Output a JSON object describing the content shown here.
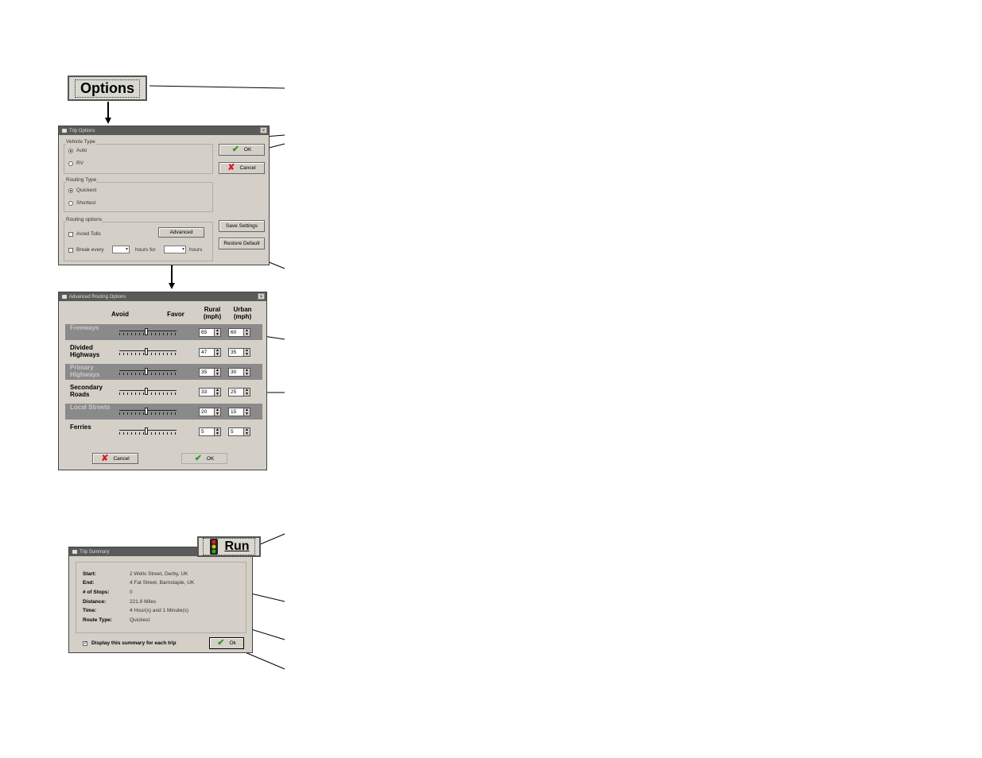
{
  "options_button": {
    "label": "Options"
  },
  "run_button": {
    "label": "Run"
  },
  "trip_options": {
    "title": "Trip Options",
    "close": "×",
    "vehicle_type": {
      "label": "Vehicle Type",
      "options": [
        {
          "label": "Auto",
          "selected": true
        },
        {
          "label": "RV",
          "selected": false
        }
      ]
    },
    "routing_type": {
      "label": "Routing Type",
      "options": [
        {
          "label": "Quickest",
          "selected": true
        },
        {
          "label": "Shortest",
          "selected": false
        }
      ]
    },
    "routing_options": {
      "label": "Routing options",
      "avoid_tolls": "Avoid Tolls",
      "advanced": "Advanced",
      "break_every": "Break every",
      "hours_for": "hours for",
      "hours": "hours"
    },
    "ok": "OK",
    "cancel": "Cancel",
    "save_settings": "Save Settings",
    "restore_default": "Restore Default"
  },
  "advanced_routing": {
    "title": "Advanced Routing Options",
    "close": "×",
    "headers": {
      "avoid": "Avoid",
      "favor": "Favor",
      "rural": "Rural (mph)",
      "urban": "Urban (mph)"
    },
    "rows": [
      {
        "name": "Freeways",
        "rural": "65",
        "urban": "60",
        "shaded": true
      },
      {
        "name": "Divided Highways",
        "rural": "47",
        "urban": "35",
        "shaded": false
      },
      {
        "name": "Primary Highways",
        "rural": "35",
        "urban": "30",
        "shaded": true
      },
      {
        "name": "Secondary Roads",
        "rural": "33",
        "urban": "25",
        "shaded": false
      },
      {
        "name": "Local Streets",
        "rural": "20",
        "urban": "15",
        "shaded": true
      },
      {
        "name": "Ferries",
        "rural": "5",
        "urban": "5",
        "shaded": false
      }
    ],
    "cancel": "Cancel",
    "ok": "OK"
  },
  "trip_summary": {
    "title": "Trip Summary",
    "fields": [
      {
        "key": "Start:",
        "value": "2 Wells Street, Derby, UK"
      },
      {
        "key": "End:",
        "value": "4 Fat Street, Barnstaple, UK"
      },
      {
        "key": "# of Stops:",
        "value": "0"
      },
      {
        "key": "Distance:",
        "value": "221.9 Miles"
      },
      {
        "key": "Time:",
        "value": "4 Hour(s) and 1 Minute(s)"
      },
      {
        "key": "Route Type:",
        "value": "Quickest"
      }
    ],
    "display_summary": "Display this summary for each trip",
    "ok": "Ok"
  }
}
